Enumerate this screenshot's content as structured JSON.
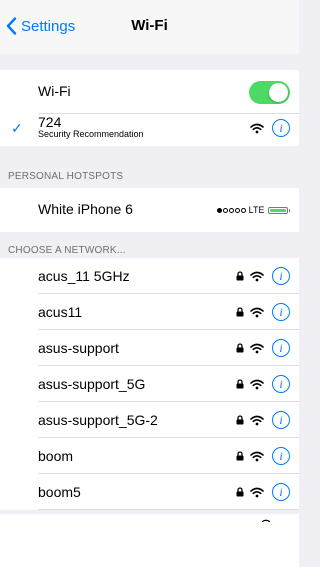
{
  "nav": {
    "back_label": "Settings",
    "title": "Wi-Fi"
  },
  "wifi_toggle": {
    "label": "Wi-Fi",
    "state": "on"
  },
  "connected": {
    "name": "724",
    "subtitle": "Security Recommendation",
    "selected": true
  },
  "sections": {
    "hotspots": "PERSONAL HOTSPOTS",
    "networks": "CHOOSE A NETWORK..."
  },
  "hotspot": {
    "name": "White iPhone 6",
    "network_type": "LTE",
    "signal_bars_filled": 1,
    "signal_bars_total": 5
  },
  "networks": [
    {
      "name": "acus_11 5GHz",
      "secured": true
    },
    {
      "name": "acus11",
      "secured": true
    },
    {
      "name": "asus-support",
      "secured": true
    },
    {
      "name": "asus-support_5G",
      "secured": true
    },
    {
      "name": "asus-support_5G-2",
      "secured": true
    },
    {
      "name": "boom",
      "secured": true
    },
    {
      "name": "boom5",
      "secured": true
    }
  ],
  "icons": {
    "info_glyph": "i",
    "check": "checkmark-icon",
    "lock": "lock-icon",
    "wifi": "wifi-signal-icon"
  },
  "colors": {
    "accent": "#007aff",
    "toggle_on": "#4cd964",
    "background": "#efeff4"
  }
}
